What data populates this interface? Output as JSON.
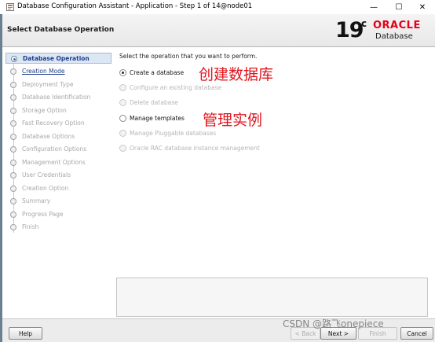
{
  "window": {
    "title": "Database Configuration Assistant - Application - Step 1 of 14@node01",
    "minimize_glyph": "—",
    "maximize_glyph": "☐",
    "close_glyph": "✕"
  },
  "header": {
    "page_title": "Select Database Operation",
    "logo_version": "19",
    "logo_suffix": "c",
    "logo_brand": "ORACLE",
    "logo_product": "Database",
    "brand_color": "#e2001a"
  },
  "nav": {
    "items": [
      {
        "label": "Database Operation",
        "state": "current"
      },
      {
        "label": "Creation Mode",
        "state": "link"
      },
      {
        "label": "Deployment Type",
        "state": "disabled"
      },
      {
        "label": "Database Identification",
        "state": "disabled"
      },
      {
        "label": "Storage Option",
        "state": "disabled"
      },
      {
        "label": "Fast Recovery Option",
        "state": "disabled"
      },
      {
        "label": "Database Options",
        "state": "disabled"
      },
      {
        "label": "Configuration Options",
        "state": "disabled"
      },
      {
        "label": "Management Options",
        "state": "disabled"
      },
      {
        "label": "User Credentials",
        "state": "disabled"
      },
      {
        "label": "Creation Option",
        "state": "disabled"
      },
      {
        "label": "Summary",
        "state": "disabled"
      },
      {
        "label": "Progress Page",
        "state": "disabled"
      },
      {
        "label": "Finish",
        "state": "disabled"
      }
    ]
  },
  "main": {
    "prompt": "Select the operation that you want to perform.",
    "options": [
      {
        "label": "Create a database",
        "selected": true,
        "enabled": true
      },
      {
        "label": "Configure an existing database",
        "selected": false,
        "enabled": false
      },
      {
        "label": "Delete database",
        "selected": false,
        "enabled": false
      },
      {
        "label": "Manage templates",
        "selected": false,
        "enabled": true
      },
      {
        "label": "Manage Pluggable databases",
        "selected": false,
        "enabled": false
      },
      {
        "label": "Oracle RAC database instance management",
        "selected": false,
        "enabled": false
      }
    ],
    "annotations": {
      "create": "创建数据库",
      "manage": "管理实例",
      "color": "#e0141e"
    }
  },
  "footer": {
    "help_label": "Help",
    "back_label": "< Back",
    "next_label": "Next >",
    "install_label": "Finish",
    "cancel_label": "Cancel"
  },
  "watermark": "CSDN @路飞onepiece"
}
